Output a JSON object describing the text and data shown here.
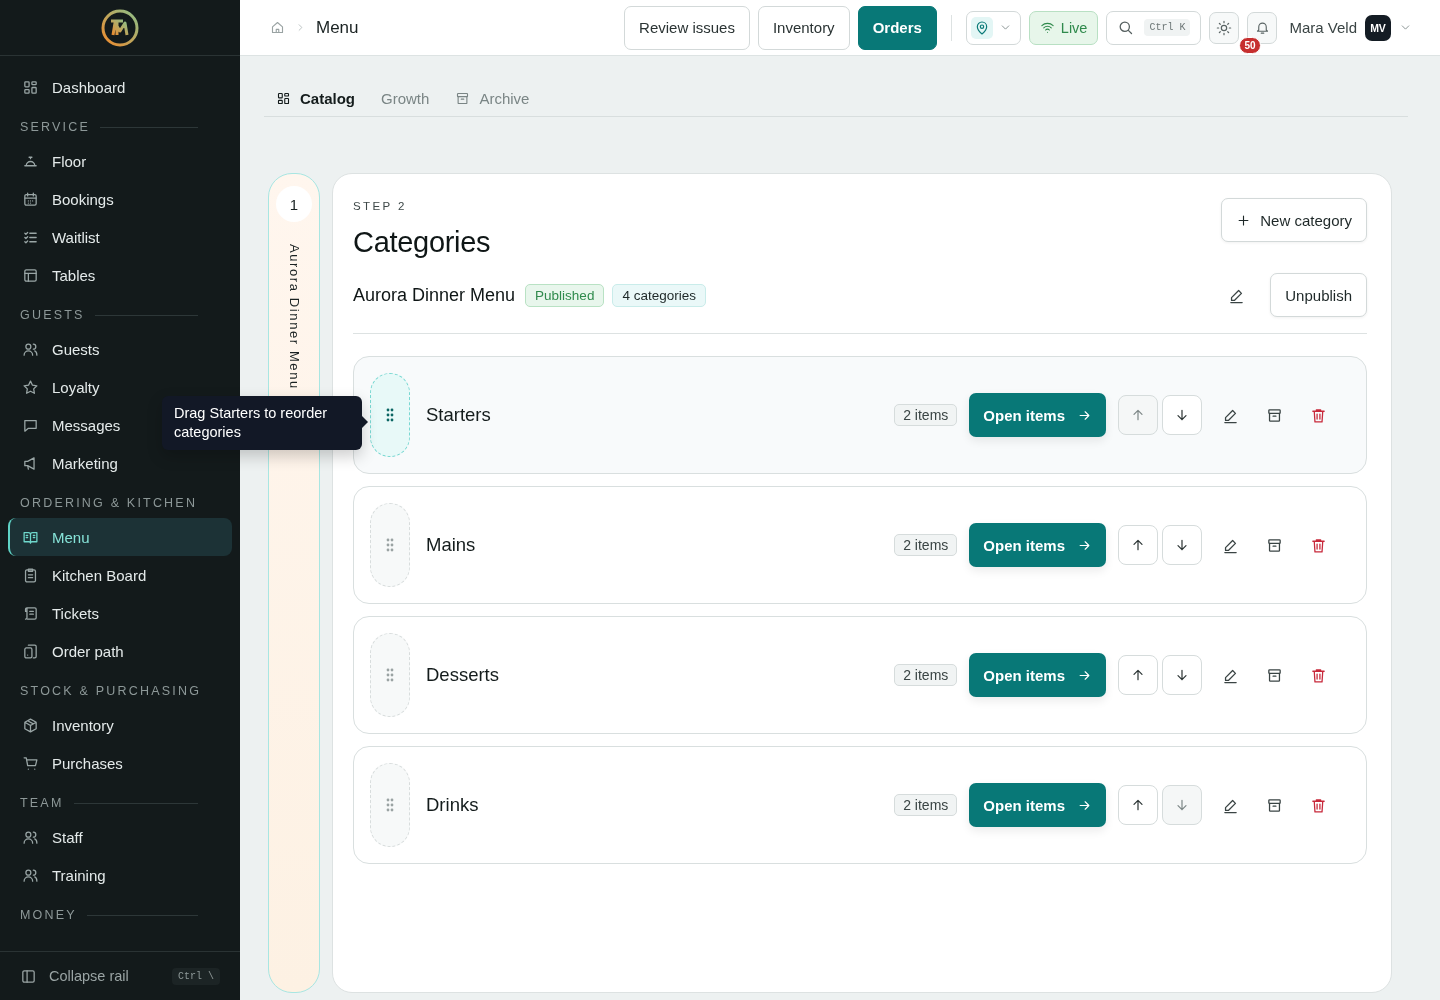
{
  "sidebar": {
    "nav": [
      {
        "kind": "item",
        "label": "Dashboard",
        "selected": false
      },
      {
        "kind": "heading",
        "label": "SERVICE"
      },
      {
        "kind": "item",
        "label": "Floor",
        "selected": false
      },
      {
        "kind": "item",
        "label": "Bookings",
        "selected": false
      },
      {
        "kind": "item",
        "label": "Waitlist",
        "selected": false
      },
      {
        "kind": "item",
        "label": "Tables",
        "selected": false
      },
      {
        "kind": "heading",
        "label": "GUESTS"
      },
      {
        "kind": "item",
        "label": "Guests",
        "selected": false
      },
      {
        "kind": "item",
        "label": "Loyalty",
        "selected": false
      },
      {
        "kind": "item",
        "label": "Messages",
        "selected": false
      },
      {
        "kind": "item",
        "label": "Marketing",
        "selected": false
      },
      {
        "kind": "heading",
        "label": "ORDERING & KITCHEN"
      },
      {
        "kind": "item",
        "label": "Menu",
        "selected": true
      },
      {
        "kind": "item",
        "label": "Kitchen Board",
        "selected": false
      },
      {
        "kind": "item",
        "label": "Tickets",
        "selected": false
      },
      {
        "kind": "item",
        "label": "Order path",
        "selected": false
      },
      {
        "kind": "heading",
        "label": "STOCK & PURCHASING"
      },
      {
        "kind": "item",
        "label": "Inventory",
        "selected": false
      },
      {
        "kind": "item",
        "label": "Purchases",
        "selected": false
      },
      {
        "kind": "heading",
        "label": "TEAM"
      },
      {
        "kind": "item",
        "label": "Staff",
        "selected": false
      },
      {
        "kind": "item",
        "label": "Training",
        "selected": false
      },
      {
        "kind": "heading",
        "label": "MONEY"
      }
    ],
    "footer": {
      "label": "Collapse rail",
      "shortcut": "Ctrl \\"
    }
  },
  "topbar": {
    "breadcrumb": "Menu",
    "actions": [
      {
        "label": "Review issues",
        "kind": "outline"
      },
      {
        "label": "Inventory",
        "kind": "outline"
      },
      {
        "label": "Orders",
        "kind": "primary"
      }
    ],
    "live": "Live",
    "search_shortcut": "Ctrl K",
    "notifications": "50",
    "user": {
      "name": "Mara Veld",
      "initials": "MV"
    }
  },
  "tabs": [
    {
      "label": "Catalog",
      "selected": true
    },
    {
      "label": "Growth",
      "selected": false
    },
    {
      "label": "Archive",
      "selected": false
    }
  ],
  "step_rail": {
    "number": "1",
    "label": "Aurora Dinner Menu"
  },
  "card": {
    "step": "STEP 2",
    "title": "Categories",
    "new_button": "New category",
    "menu": {
      "name": "Aurora Dinner Menu",
      "status": "Published",
      "count": "4 categories",
      "unpublish": "Unpublish"
    },
    "categories": [
      {
        "name": "Starters",
        "count": "2 items",
        "open": "Open items",
        "selected": true,
        "can_move_up": false,
        "can_move_down": true
      },
      {
        "name": "Mains",
        "count": "2 items",
        "open": "Open items",
        "selected": false,
        "can_move_up": true,
        "can_move_down": true
      },
      {
        "name": "Desserts",
        "count": "2 items",
        "open": "Open items",
        "selected": false,
        "can_move_up": true,
        "can_move_down": true
      },
      {
        "name": "Drinks",
        "count": "2 items",
        "open": "Open items",
        "selected": false,
        "can_move_up": true,
        "can_move_down": false
      }
    ]
  },
  "tooltip": "Drag Starters to reorder categories"
}
